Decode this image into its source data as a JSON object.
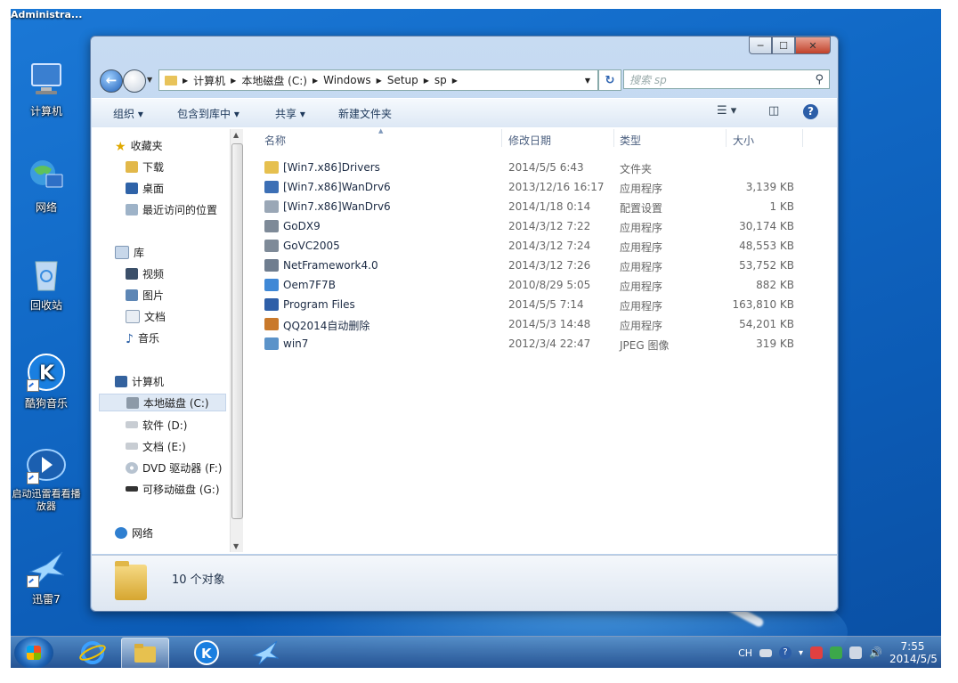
{
  "desktop": {
    "user_label": "Administra...",
    "icons": [
      {
        "label": "计算机",
        "icon": "computer-icon"
      },
      {
        "label": "网络",
        "icon": "network-globe-icon"
      },
      {
        "label": "回收站",
        "icon": "recycle-bin-icon"
      },
      {
        "label": "酷狗音乐",
        "icon": "kugou-icon"
      },
      {
        "label": "启动迅雷看看播放器",
        "icon": "xunlei-player-icon"
      },
      {
        "label": "迅雷7",
        "icon": "xunlei-bird-icon"
      }
    ]
  },
  "explorer": {
    "address": {
      "segments": [
        "计算机",
        "本地磁盘 (C:)",
        "Windows",
        "Setup",
        "sp"
      ]
    },
    "search": {
      "placeholder": "搜索 sp"
    },
    "toolbar": {
      "organize": "组织 ▾",
      "include_in_library": "包含到库中 ▾",
      "share": "共享 ▾",
      "new_folder": "新建文件夹",
      "help": "?"
    },
    "nav": {
      "favorites": "收藏夹",
      "downloads": "下载",
      "desktop": "桌面",
      "recent": "最近访问的位置",
      "libraries": "库",
      "videos": "视频",
      "pictures": "图片",
      "documents": "文档",
      "music": "音乐",
      "computer": "计算机",
      "drive_c": "本地磁盘 (C:)",
      "drive_d": "软件 (D:)",
      "drive_e": "文档 (E:)",
      "drive_f": "DVD 驱动器 (F:)",
      "drive_g": "可移动磁盘 (G:)",
      "network": "网络"
    },
    "columns": {
      "name": "名称",
      "date": "修改日期",
      "type": "类型",
      "size": "大小"
    },
    "files": [
      {
        "name": "[Win7.x86]Drivers",
        "date": "2014/5/5 6:43",
        "type": "文件夹",
        "size": "",
        "color": "#e6c04f"
      },
      {
        "name": "[Win7.x86]WanDrv6",
        "date": "2013/12/16 16:17",
        "type": "应用程序",
        "size": "3,139 KB",
        "color": "#3c6fb5"
      },
      {
        "name": "[Win7.x86]WanDrv6",
        "date": "2014/1/18 0:14",
        "type": "配置设置",
        "size": "1 KB",
        "color": "#9aa7b6"
      },
      {
        "name": "GoDX9",
        "date": "2014/3/12 7:22",
        "type": "应用程序",
        "size": "30,174 KB",
        "color": "#7e8a98"
      },
      {
        "name": "GoVC2005",
        "date": "2014/3/12 7:24",
        "type": "应用程序",
        "size": "48,553 KB",
        "color": "#7e8a98"
      },
      {
        "name": "NetFramework4.0",
        "date": "2014/3/12 7:26",
        "type": "应用程序",
        "size": "53,752 KB",
        "color": "#6f7d8f"
      },
      {
        "name": "Oem7F7B",
        "date": "2010/8/29 5:05",
        "type": "应用程序",
        "size": "882 KB",
        "color": "#3f88d6"
      },
      {
        "name": "Program Files",
        "date": "2014/5/5 7:14",
        "type": "应用程序",
        "size": "163,810 KB",
        "color": "#2e5fa8"
      },
      {
        "name": "QQ2014自动删除",
        "date": "2014/5/3 14:48",
        "type": "应用程序",
        "size": "54,201 KB",
        "color": "#c9792b"
      },
      {
        "name": "win7",
        "date": "2012/3/4 22:47",
        "type": "JPEG 图像",
        "size": "319 KB",
        "color": "#5b93c9"
      }
    ],
    "status": {
      "count": "10 个对象"
    }
  },
  "taskbar": {
    "tray": {
      "lang": "CH",
      "time": "7:55",
      "date": "2014/5/5"
    }
  },
  "colors": {
    "accent": "#1169c6",
    "close": "#c0412a",
    "folder": "#e6c04f"
  }
}
